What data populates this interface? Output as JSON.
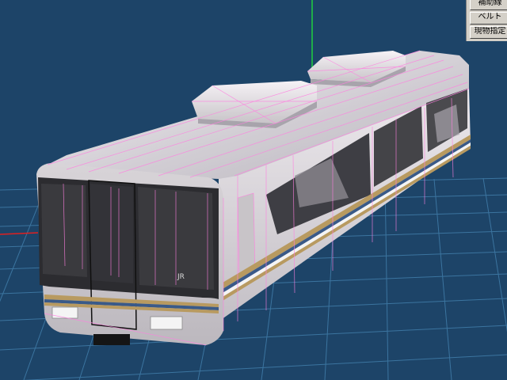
{
  "panel": {
    "buttons": [
      {
        "id": "partial",
        "label": "補助線"
      },
      {
        "id": "belt",
        "label": "ベルト"
      },
      {
        "id": "object-spec",
        "label": "現物指定"
      }
    ]
  },
  "model": {
    "logo_text": "JR"
  },
  "colors": {
    "background": "#1d4468",
    "grid": "#3f7aa6",
    "axis_y": "#20d040",
    "axis_x": "#e02020",
    "wireframe": "#ff7fe0",
    "stripe_gold": "#b89a60",
    "stripe_blue": "#3a5a88"
  }
}
